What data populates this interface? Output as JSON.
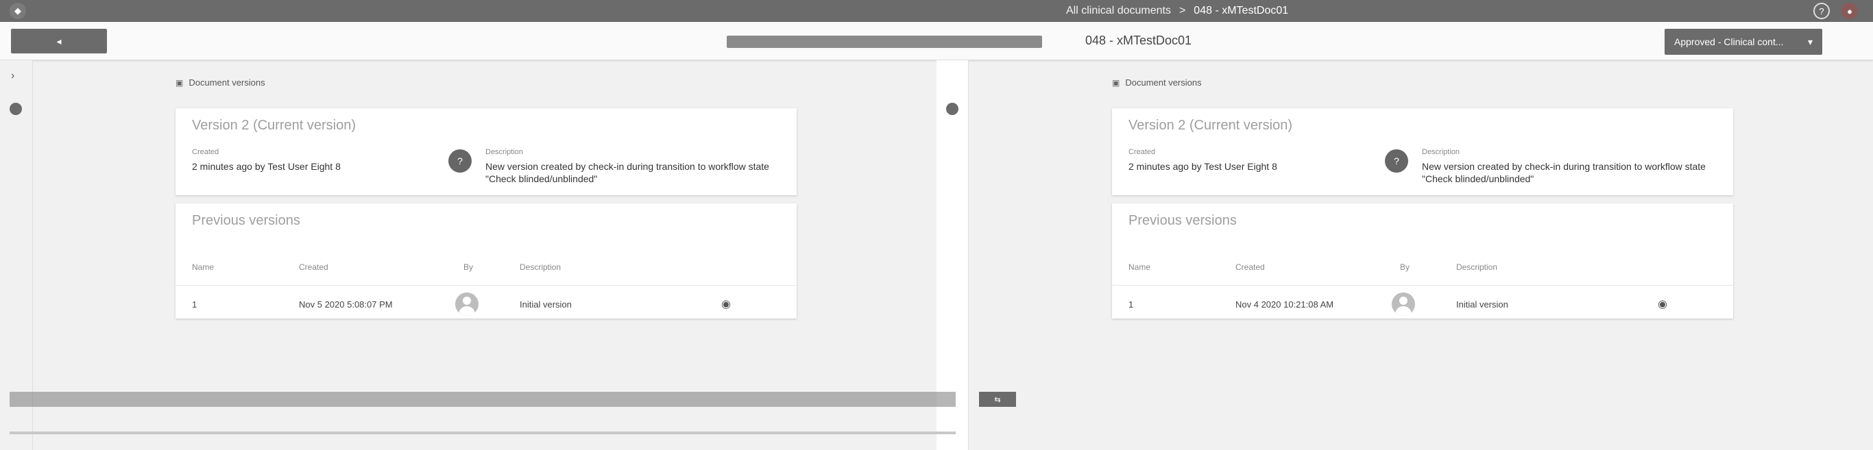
{
  "topbar": {
    "breadcrumbs": [
      "All clinical documents",
      "048 - xMTestDoc01"
    ],
    "separator": ">"
  },
  "subbar": {
    "doc_title": "048 - xMTestDoc01",
    "status_label": "Approved - Clinical cont...",
    "status_caret": "▾",
    "more_icon": "⋮"
  },
  "panes": [
    {
      "section_title": "Document versions",
      "current": {
        "title": "Version 2 (Current version)",
        "created_label": "Created",
        "created_value": "2 minutes ago by Test User Eight 8",
        "description_label": "Description",
        "description_value": "New version created by check-in during transition to workflow state \"Check blinded/unblinded\"",
        "avatar_glyph": "?"
      },
      "previous": {
        "title": "Previous versions",
        "columns": [
          "Name",
          "Created",
          "By",
          "Description"
        ],
        "rows": [
          {
            "name": "1",
            "created": "Nov 5 2020 5:08:07 PM",
            "description": "Initial version"
          }
        ]
      }
    },
    {
      "section_title": "Document versions",
      "current": {
        "title": "Version 2 (Current version)",
        "created_label": "Created",
        "created_value": "2 minutes ago by Test User Eight 8",
        "description_label": "Description",
        "description_value": "New version created by check-in during transition to workflow state \"Check blinded/unblinded\"",
        "avatar_glyph": "?"
      },
      "previous": {
        "title": "Previous versions",
        "columns": [
          "Name",
          "Created",
          "By",
          "Description"
        ],
        "rows": [
          {
            "name": "1",
            "created": "Nov 4 2020 10:21:08 AM",
            "description": "Initial version"
          }
        ]
      }
    }
  ],
  "left_rail": {
    "chevron": "›"
  },
  "colors": {
    "topbar": "#6b6b6b",
    "background": "#f1f1f1",
    "card": "#ffffff"
  }
}
